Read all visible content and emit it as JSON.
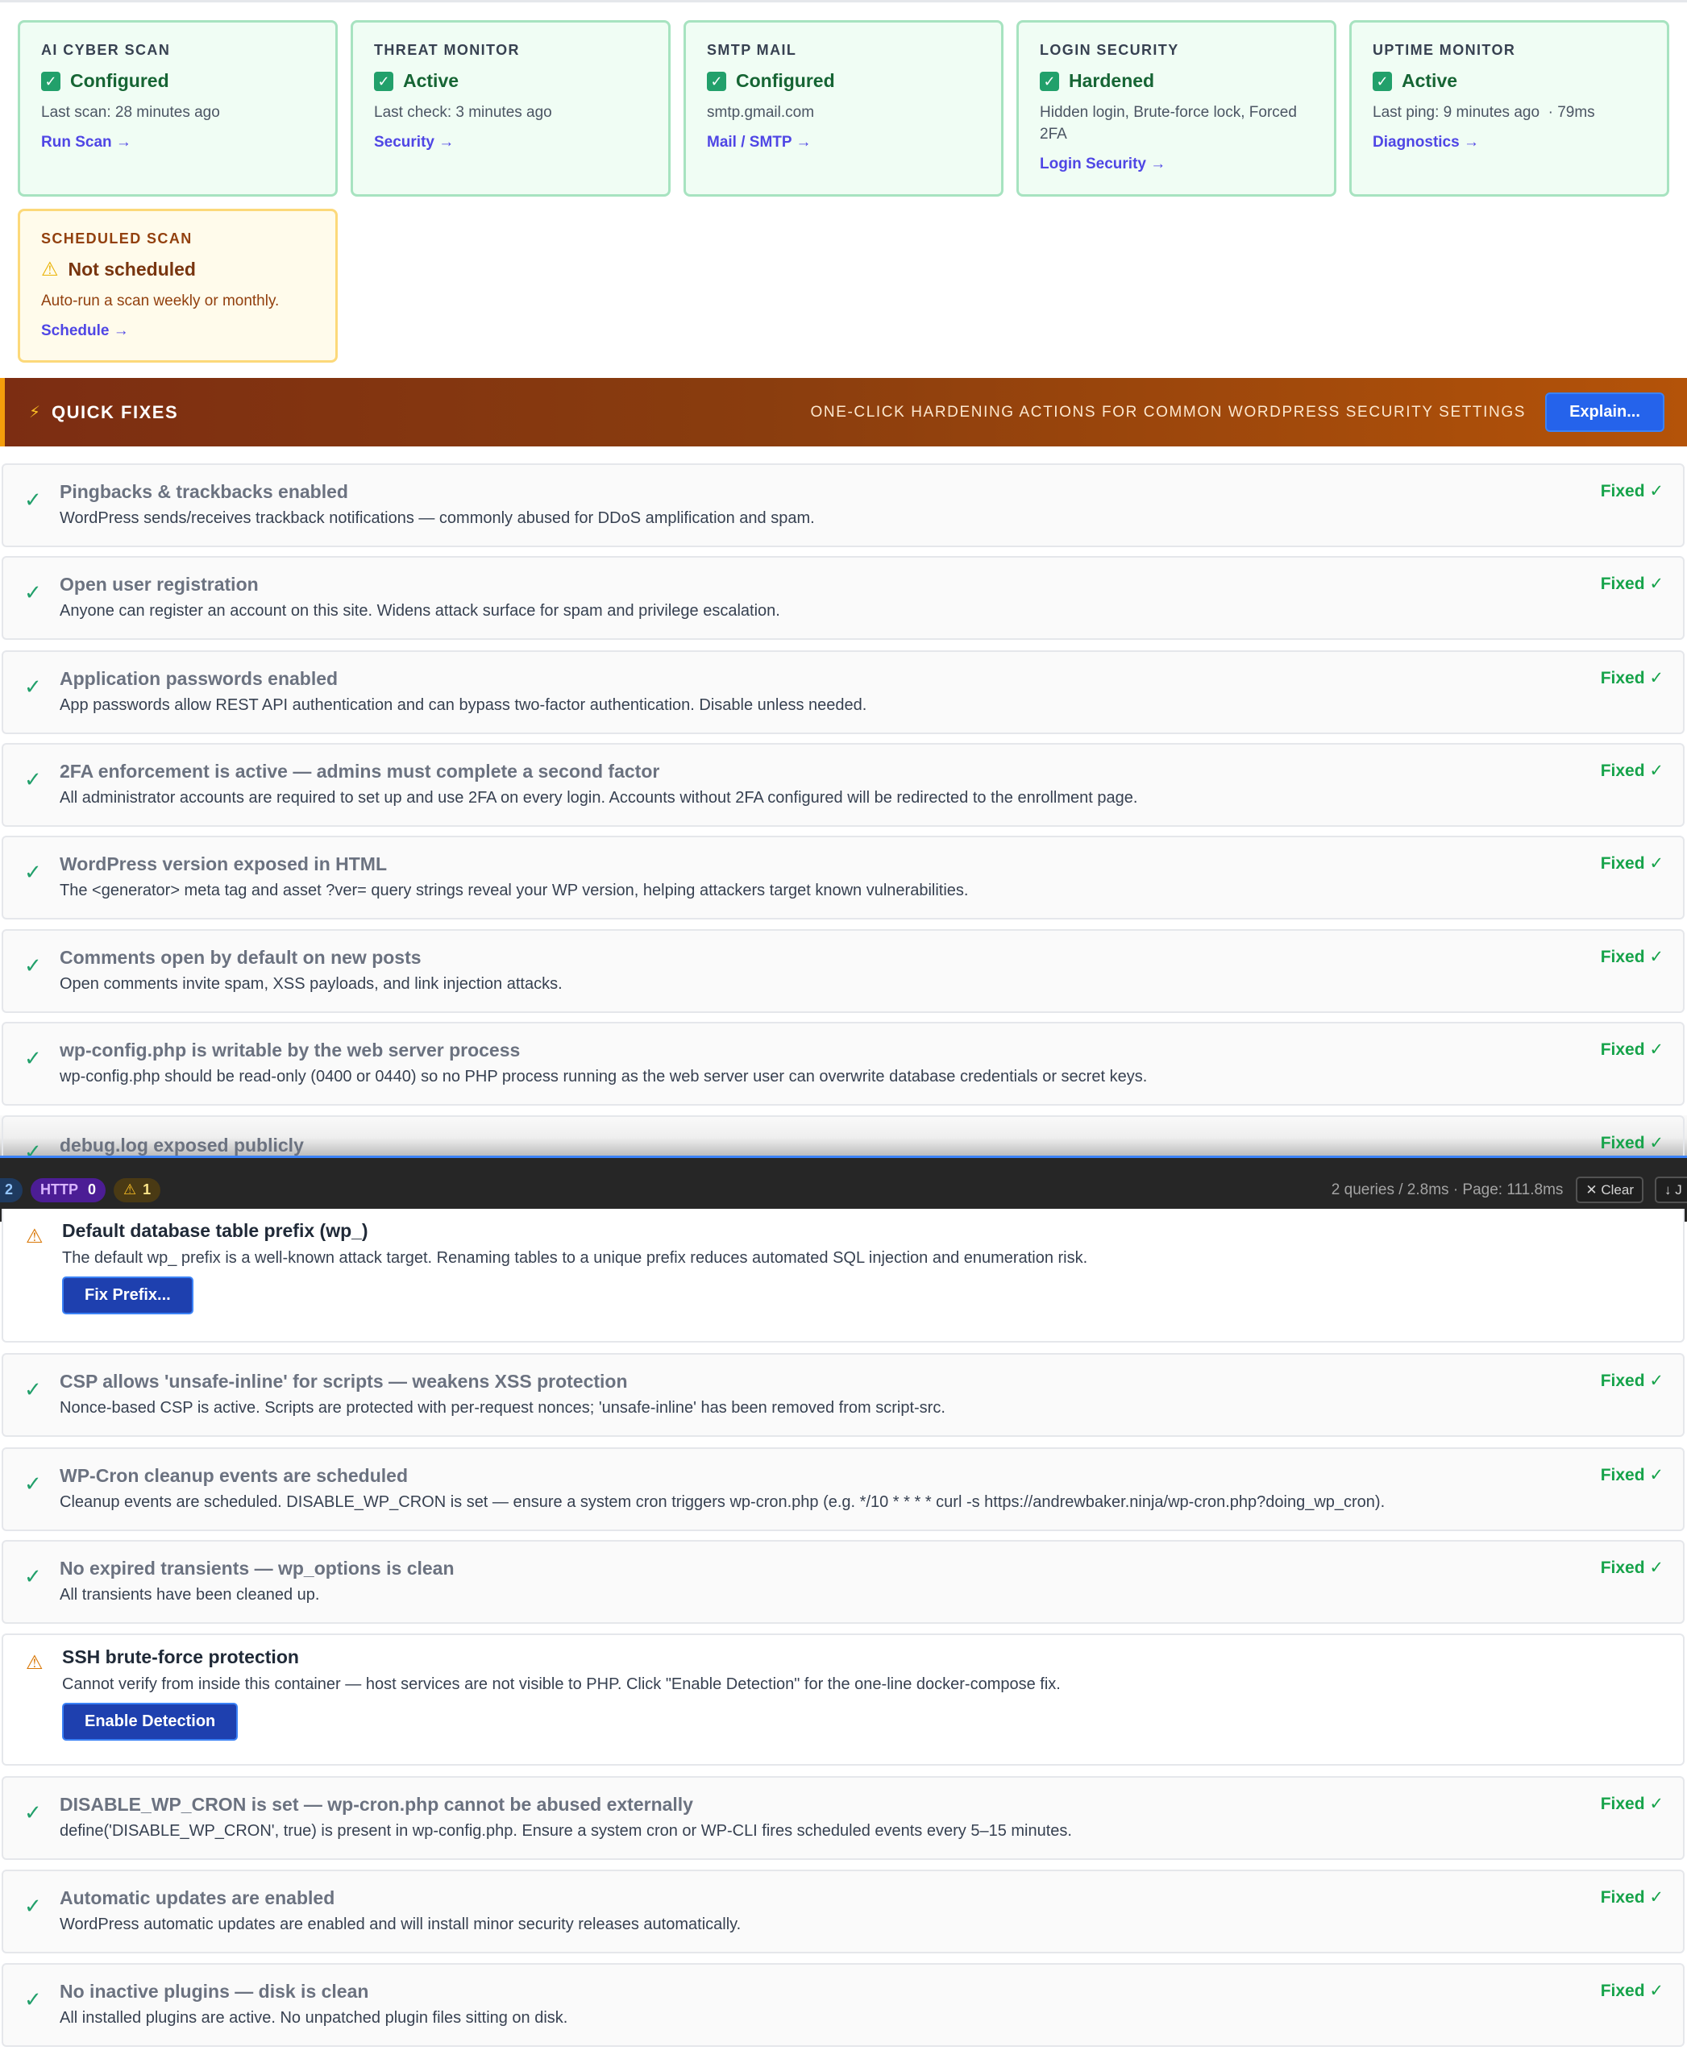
{
  "cards": [
    {
      "title": "AI CYBER SCAN",
      "status": "Configured",
      "detail": "Last scan: 28 minutes ago",
      "link": "Run Scan →"
    },
    {
      "title": "THREAT MONITOR",
      "status": "Active",
      "detail": "Last check: 3 minutes ago",
      "link": "Security →"
    },
    {
      "title": "SMTP MAIL",
      "status": "Configured",
      "detail": "smtp.gmail.com",
      "link": "Mail / SMTP →"
    },
    {
      "title": "LOGIN SECURITY",
      "status": "Hardened",
      "detail": "Hidden login, Brute-force lock, Forced 2FA",
      "link": "Login Security →"
    },
    {
      "title": "UPTIME MONITOR",
      "status": "Active",
      "detail": "Last ping: 9 minutes ago  · 79ms",
      "link": "Diagnostics →"
    },
    {
      "title": "SCHEDULED SCAN",
      "status": "Not scheduled",
      "detail": "Auto-run a scan weekly or monthly.",
      "link": "Schedule →"
    }
  ],
  "quick_fixes": {
    "title": "QUICK FIXES",
    "subtitle": "ONE-CLICK HARDENING ACTIONS FOR COMMON WORDPRESS SECURITY SETTINGS",
    "explain_label": "Explain...",
    "fixed_label": "Fixed ✓",
    "items_top": [
      {
        "title": "Pingbacks & trackbacks enabled",
        "desc": "WordPress sends/receives trackback notifications — commonly abused for DDoS amplification and spam."
      },
      {
        "title": "Open user registration",
        "desc": "Anyone can register an account on this site. Widens attack surface for spam and privilege escalation."
      },
      {
        "title": "Application passwords enabled",
        "desc": "App passwords allow REST API authentication and can bypass two-factor authentication. Disable unless needed."
      },
      {
        "title": "2FA enforcement is active — admins must complete a second factor",
        "desc": "All administrator accounts are required to set up and use 2FA on every login. Accounts without 2FA configured will be redirected to the enrollment page."
      },
      {
        "title": "WordPress version exposed in HTML",
        "desc": "The <generator> meta tag and asset ?ver= query strings reveal your WP version, helping attackers target known vulnerabilities."
      },
      {
        "title": "Comments open by default on new posts",
        "desc": "Open comments invite spam, XSS payloads, and link injection attacks."
      },
      {
        "title": "wp-config.php is writable by the web server process",
        "desc": "wp-config.php should be read-only (0400 or 0440) so no PHP process running as the web server user can overwrite database credentials or secret keys."
      }
    ],
    "cut_item": {
      "title": "debug.log exposed publicly"
    },
    "warn_prefix": {
      "title": "Default database table prefix (wp_)",
      "desc": "The default wp_ prefix is a well-known attack target. Renaming tables to a unique prefix reduces automated SQL injection and enumeration risk.",
      "button": "Fix Prefix..."
    },
    "items_mid": [
      {
        "title": "CSP allows 'unsafe-inline' for scripts — weakens XSS protection",
        "desc": "Nonce-based CSP is active. Scripts are protected with per-request nonces; 'unsafe-inline' has been removed from script-src."
      },
      {
        "title": "WP-Cron cleanup events are scheduled",
        "desc": "Cleanup events are scheduled. DISABLE_WP_CRON is set — ensure a system cron triggers wp-cron.php (e.g. */10 * * * * curl -s https://andrewbaker.ninja/wp-cron.php?doing_wp_cron)."
      },
      {
        "title": "No expired transients — wp_options is clean",
        "desc": "All transients have been cleaned up."
      }
    ],
    "warn_ssh": {
      "title": "SSH brute-force protection",
      "desc": "Cannot verify from inside this container — host services are not visible to PHP. Click \"Enable Detection\" for the one-line docker-compose fix.",
      "button": "Enable Detection"
    },
    "items_bottom": [
      {
        "title": "DISABLE_WP_CRON is set — wp-cron.php cannot be abused externally",
        "desc": "define('DISABLE_WP_CRON', true) is present in wp-config.php. Ensure a system cron or WP-CLI fires scheduled events every 5–15 minutes."
      },
      {
        "title": "Automatic updates are enabled",
        "desc": "WordPress automatic updates are enabled and will install minor security releases automatically."
      },
      {
        "title": "No inactive plugins — disk is clean",
        "desc": "All installed plugins are active. No unpatched plugin files sitting on disk."
      }
    ]
  },
  "debug_bar": {
    "db_count": "2",
    "http_label": "HTTP",
    "http_count": "0",
    "warn_count": "1",
    "stats": "2 queries / 2.8ms · Page: 111.8ms",
    "clear_label": "✕ Clear",
    "download_label": "↓ J"
  },
  "colors": {
    "accent": "#2563eb",
    "success": "#16a34a",
    "warning": "#d97706",
    "banner": "#8a3d0e"
  }
}
